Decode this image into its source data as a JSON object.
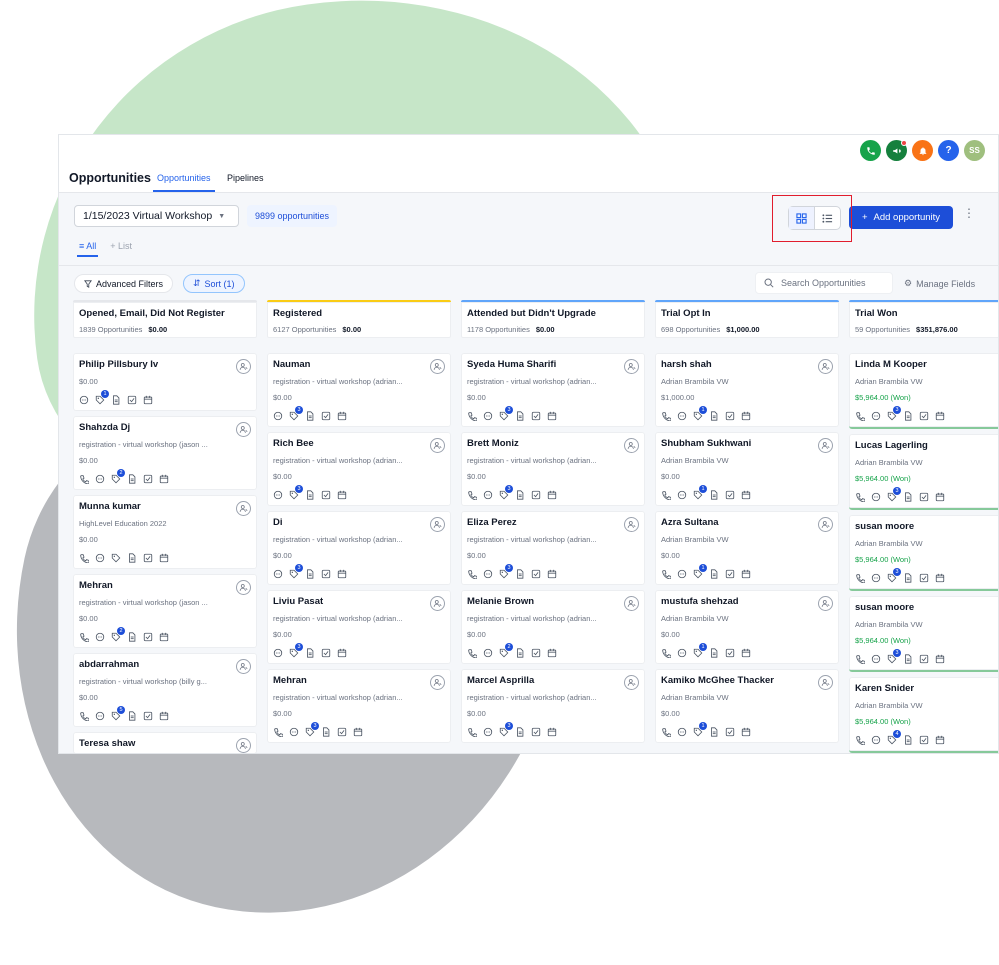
{
  "header": {
    "title": "Opportunities",
    "tabs": [
      "Opportunities",
      "Pipelines"
    ],
    "avatar_initials": "SS",
    "help_glyph": "?",
    "icon_names": [
      "phone-icon",
      "megaphone-icon",
      "bell-icon",
      "help-icon",
      "avatar"
    ],
    "icon_colors": [
      "#16a34a",
      "#15803d",
      "#f97316",
      "#2563eb",
      "#9fbf7e"
    ]
  },
  "toolbar": {
    "pipeline": "1/15/2023 Virtual Workshop",
    "opportunity_count": "9899 opportunities",
    "add_label": "Add opportunity",
    "subtab_all": "All",
    "subtab_list": "List"
  },
  "filters": {
    "advanced": "Advanced Filters",
    "sort": "Sort (1)",
    "search_placeholder": "Search Opportunities",
    "manage": "Manage Fields"
  },
  "columns": [
    {
      "title": "Opened, Email, Did Not Register",
      "count": "1839 Opportunities",
      "total": "$0.00",
      "accent": "#e5e7eb",
      "cards": [
        {
          "name": "Philip Pillsbury Iv",
          "lines": [],
          "value": "$0.00",
          "won": false,
          "icons": [
            "chat",
            "tag:1",
            "doc",
            "check",
            "cal"
          ]
        },
        {
          "name": "Shahzda Dj",
          "lines": [
            "registration - virtual workshop (jason ..."
          ],
          "value": "$0.00",
          "won": false,
          "icons": [
            "phone",
            "chat",
            "tag:2",
            "doc",
            "check",
            "cal"
          ]
        },
        {
          "name": "Munna kumar",
          "lines": [
            "HighLevel Education 2022"
          ],
          "value": "$0.00",
          "won": false,
          "icons": [
            "phone",
            "chat",
            "tag",
            "doc",
            "check",
            "cal"
          ]
        },
        {
          "name": "Mehran",
          "lines": [
            "registration - virtual workshop (jason ..."
          ],
          "value": "$0.00",
          "won": false,
          "icons": [
            "phone",
            "chat",
            "tag:2",
            "doc",
            "check",
            "cal"
          ]
        },
        {
          "name": "abdarrahman",
          "lines": [
            "registration - virtual workshop (billy g..."
          ],
          "value": "$0.00",
          "won": false,
          "icons": [
            "phone",
            "chat",
            "tag:5",
            "doc",
            "check",
            "cal"
          ]
        },
        {
          "name": "Teresa shaw",
          "lines": [],
          "value": "",
          "won": false,
          "icons": []
        }
      ]
    },
    {
      "title": "Registered",
      "count": "6127 Opportunities",
      "total": "$0.00",
      "accent": "#facc15",
      "cards": [
        {
          "name": "Nauman",
          "lines": [
            "registration - virtual workshop (adrian..."
          ],
          "value": "$0.00",
          "won": false,
          "icons": [
            "chat",
            "tag:3",
            "doc",
            "check",
            "cal"
          ]
        },
        {
          "name": "Rich Bee",
          "lines": [
            "registration - virtual workshop (adrian..."
          ],
          "value": "$0.00",
          "won": false,
          "icons": [
            "chat",
            "tag:3",
            "doc",
            "check",
            "cal"
          ]
        },
        {
          "name": "Di",
          "lines": [
            "registration - virtual workshop (adrian..."
          ],
          "value": "$0.00",
          "won": false,
          "icons": [
            "chat",
            "tag:3",
            "doc",
            "check",
            "cal"
          ]
        },
        {
          "name": "Liviu Pasat",
          "lines": [
            "registration - virtual workshop (adrian..."
          ],
          "value": "$0.00",
          "won": false,
          "icons": [
            "chat",
            "tag:3",
            "doc",
            "check",
            "cal"
          ]
        },
        {
          "name": "Mehran",
          "lines": [
            "registration - virtual workshop (adrian..."
          ],
          "value": "$0.00",
          "won": false,
          "icons": [
            "phone",
            "chat",
            "tag:3",
            "doc",
            "check",
            "cal"
          ]
        }
      ]
    },
    {
      "title": "Attended but Didn't Upgrade",
      "count": "1178 Opportunities",
      "total": "$0.00",
      "accent": "#60a5fa",
      "cards": [
        {
          "name": "Syeda Huma Sharifi",
          "lines": [
            "registration - virtual workshop (adrian..."
          ],
          "value": "$0.00",
          "won": false,
          "icons": [
            "phone",
            "chat",
            "tag:3",
            "doc",
            "check",
            "cal"
          ]
        },
        {
          "name": "Brett Moniz",
          "lines": [
            "registration - virtual workshop (adrian..."
          ],
          "value": "$0.00",
          "won": false,
          "icons": [
            "phone",
            "chat",
            "tag:3",
            "doc",
            "check",
            "cal"
          ]
        },
        {
          "name": "Eliza Perez",
          "lines": [
            "registration - virtual workshop (adrian..."
          ],
          "value": "$0.00",
          "won": false,
          "icons": [
            "phone",
            "chat",
            "tag:3",
            "doc",
            "check",
            "cal"
          ]
        },
        {
          "name": "Melanie Brown",
          "lines": [
            "registration - virtual workshop (adrian..."
          ],
          "value": "$0.00",
          "won": false,
          "icons": [
            "phone",
            "chat",
            "tag:2",
            "doc",
            "check",
            "cal"
          ]
        },
        {
          "name": "Marcel Asprilla",
          "lines": [
            "registration - virtual workshop (adrian..."
          ],
          "value": "$0.00",
          "won": false,
          "icons": [
            "phone",
            "chat",
            "tag:3",
            "doc",
            "check",
            "cal"
          ]
        }
      ]
    },
    {
      "title": "Trial Opt In",
      "count": "698 Opportunities",
      "total": "$1,000.00",
      "accent": "#60a5fa",
      "cards": [
        {
          "name": "harsh shah",
          "lines": [
            "Adrian Brambila VW"
          ],
          "value": "$1,000.00",
          "won": false,
          "icons": [
            "phone",
            "chat",
            "tag:1",
            "doc",
            "check",
            "cal"
          ]
        },
        {
          "name": "Shubham Sukhwani",
          "lines": [
            "Adrian Brambila VW"
          ],
          "value": "$0.00",
          "won": false,
          "icons": [
            "phone",
            "chat",
            "tag:1",
            "doc",
            "check",
            "cal"
          ]
        },
        {
          "name": "Azra Sultana",
          "lines": [
            "Adrian Brambila VW"
          ],
          "value": "$0.00",
          "won": false,
          "icons": [
            "phone",
            "chat",
            "tag:1",
            "doc",
            "check",
            "cal"
          ]
        },
        {
          "name": "mustufa shehzad",
          "lines": [
            "Adrian Brambila VW"
          ],
          "value": "$0.00",
          "won": false,
          "icons": [
            "phone",
            "chat",
            "tag:1",
            "doc",
            "check",
            "cal"
          ]
        },
        {
          "name": "Kamiko McGhee Thacker",
          "lines": [
            "Adrian Brambila VW"
          ],
          "value": "$0.00",
          "won": false,
          "icons": [
            "phone",
            "chat",
            "tag:1",
            "doc",
            "check",
            "cal"
          ]
        }
      ]
    },
    {
      "title": "Trial Won",
      "count": "59 Opportunities",
      "total": "$351,876.00",
      "accent": "#60a5fa",
      "cards": [
        {
          "name": "Linda M Kooper",
          "lines": [
            "Adrian Brambila VW"
          ],
          "value": "$5,964.00 (Won)",
          "won": true,
          "icons": [
            "phone",
            "chat",
            "tag:3",
            "doc",
            "check",
            "cal"
          ]
        },
        {
          "name": "Lucas Lagerling",
          "lines": [
            "Adrian Brambila VW"
          ],
          "value": "$5,964.00 (Won)",
          "won": true,
          "icons": [
            "phone",
            "chat",
            "tag:3",
            "doc",
            "check",
            "cal"
          ]
        },
        {
          "name": "susan moore",
          "lines": [
            "Adrian Brambila VW"
          ],
          "value": "$5,964.00 (Won)",
          "won": true,
          "icons": [
            "phone",
            "chat",
            "tag:3",
            "doc",
            "check",
            "cal"
          ]
        },
        {
          "name": "susan moore",
          "lines": [
            "Adrian Brambila VW"
          ],
          "value": "$5,964.00 (Won)",
          "won": true,
          "icons": [
            "phone",
            "chat",
            "tag:3",
            "doc",
            "check",
            "cal"
          ]
        },
        {
          "name": "Karen Snider",
          "lines": [
            "Adrian Brambila VW"
          ],
          "value": "$5,964.00 (Won)",
          "won": true,
          "icons": [
            "phone",
            "chat",
            "tag:4",
            "doc",
            "check",
            "cal"
          ]
        }
      ]
    }
  ]
}
